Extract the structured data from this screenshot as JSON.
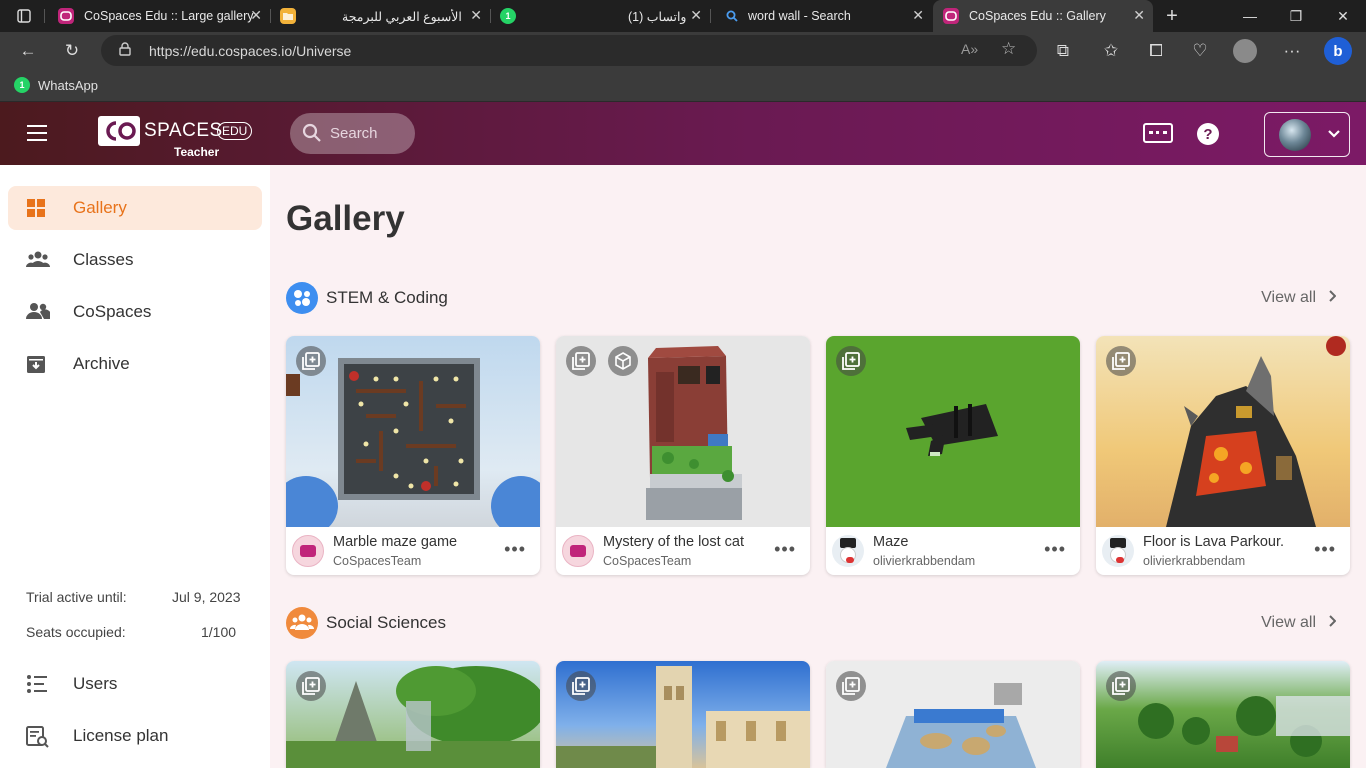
{
  "browser": {
    "tabs": [
      {
        "title": "CoSpaces Edu :: Large gallery",
        "icon": "cospaces-icon"
      },
      {
        "title": "الأسبوع العربي للبرمجة",
        "icon": "folder-icon"
      },
      {
        "title": "(1) واتساب",
        "icon": "whatsapp-icon"
      },
      {
        "title": "word wall - Search",
        "icon": "search-icon"
      },
      {
        "title": "CoSpaces Edu :: Gallery",
        "icon": "cospaces-icon"
      }
    ],
    "url": "https://edu.cospaces.io/Universe",
    "bookmarks": [
      {
        "label": "WhatsApp",
        "icon": "whatsapp-icon"
      }
    ]
  },
  "header": {
    "logo_text": "SPACES",
    "logo_badge": "EDU",
    "logo_subtitle": "Teacher",
    "search_placeholder": "Search"
  },
  "sidebar": {
    "items": [
      {
        "label": "Gallery",
        "icon": "grid-icon",
        "active": true
      },
      {
        "label": "Classes",
        "icon": "group-icon",
        "active": false
      },
      {
        "label": "CoSpaces",
        "icon": "people-icon",
        "active": false
      },
      {
        "label": "Archive",
        "icon": "archive-icon",
        "active": false
      }
    ],
    "trial_label": "Trial active until:",
    "trial_value": "Jul 9, 2023",
    "seats_label": "Seats occupied:",
    "seats_value": "1/100",
    "bottom_items": [
      {
        "label": "Users",
        "icon": "list-icon"
      },
      {
        "label": "License plan",
        "icon": "license-icon"
      }
    ]
  },
  "main": {
    "title": "Gallery",
    "sections": [
      {
        "title": "STEM & Coding",
        "view_all": "View all",
        "cards": [
          {
            "title": "Marble maze game",
            "author": "CoSpacesTeam"
          },
          {
            "title": "Mystery of the lost cat",
            "author": "CoSpacesTeam"
          },
          {
            "title": "Maze",
            "author": "olivierkrabbendam"
          },
          {
            "title": "Floor is Lava Parkour.",
            "author": "olivierkrabbendam"
          }
        ]
      },
      {
        "title": "Social Sciences",
        "view_all": "View all",
        "cards": []
      }
    ]
  },
  "colors": {
    "header_start": "#4c1a1e",
    "header_end": "#7c1a66",
    "accent_orange": "#e8731b",
    "active_nav_bg": "#fde9dc",
    "stem_icon": "#3d8ef0",
    "social_icon": "#f08a3c"
  }
}
